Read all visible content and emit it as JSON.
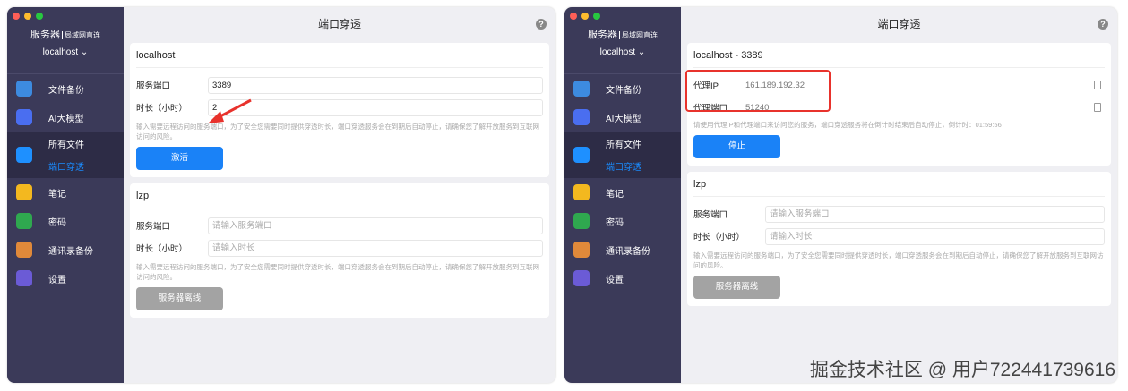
{
  "app": {
    "brand": "服务器",
    "brand_sub": "局域网直连",
    "host": "localhost",
    "title": "端口穿透",
    "help": "?"
  },
  "sidebar": [
    {
      "label": "文件备份",
      "color": "#3d8be0"
    },
    {
      "label": "AI大模型",
      "color": "#4a6ef0"
    },
    {
      "label": "所有文件",
      "sub": "端口穿透",
      "color": "#1e90ff"
    },
    {
      "label": "笔记",
      "color": "#f3b81f"
    },
    {
      "label": "密码",
      "color": "#2fa84f"
    },
    {
      "label": "通讯录备份",
      "color": "#e0893a"
    },
    {
      "label": "设置",
      "color": "#6b5bd6"
    }
  ],
  "left": {
    "card1": {
      "title": "localhost",
      "port_label": "服务端口",
      "port": "3389",
      "dur_label": "时长（小时）",
      "dur": "2",
      "hint": "输入需要远程访问的服务端口，为了安全您需要同时提供穿透时长，端口穿透服务会在到期后自动停止，请确保您了解开放服务到互联网访问的风险。",
      "button": "激活"
    },
    "card2": {
      "title": "lzp",
      "port_label": "服务端口",
      "port_ph": "请输入服务端口",
      "dur_label": "时长（小时）",
      "dur_ph": "请输入时长",
      "hint": "输入需要远程访问的服务端口，为了安全您需要同时提供穿透时长，端口穿透服务会在到期后自动停止，请确保您了解开放服务到互联网访问的风险。",
      "button": "服务器离线"
    }
  },
  "right": {
    "card1": {
      "title": "localhost - 3389",
      "ip_label": "代理IP",
      "ip": "161.189.192.32",
      "port_label": "代理端口",
      "port": "51240",
      "hint": "请使用代理IP和代理端口来访问您的服务，端口穿透服务将在倒计时结束后自动停止，倒计时：01:59:56",
      "button": "停止"
    },
    "card2": {
      "title": "lzp",
      "port_label": "服务端口",
      "port_ph": "请输入服务端口",
      "dur_label": "时长（小时）",
      "dur_ph": "请输入时长",
      "hint": "输入需要远程访问的服务端口，为了安全您需要同时提供穿透时长，端口穿透服务会在到期后自动停止，请确保您了解开放服务到互联网访问的风险。",
      "button": "服务器离线"
    }
  },
  "watermark": "掘金技术社区 @ 用户722441739616"
}
